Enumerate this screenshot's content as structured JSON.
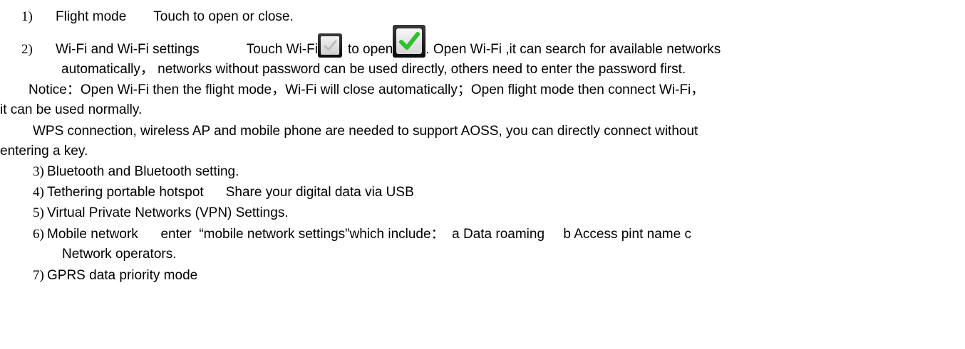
{
  "items": {
    "i1": {
      "num": "1)",
      "title": "Flight mode",
      "desc": "Touch to open or close."
    },
    "i2": {
      "num": "2)",
      "title": "Wi-Fi and Wi-Fi settings",
      "touch": "Touch Wi-Fi",
      "to_open": "to open",
      "rest": ". Open Wi-Fi ,it can search for available networks",
      "cont": "automatically， networks without password can be used directly, others need to enter the password first.",
      "notice_1": "Notice：Open Wi-Fi then the flight mode，Wi-Fi will close automatically；Open flight mode then connect Wi-Fi，",
      "notice_2": "it can be used normally.",
      "wps_1": "WPS connection, wireless AP and mobile phone are needed to support AOSS, you can directly connect without",
      "wps_2": "entering a key."
    },
    "i3": {
      "num": "3)",
      "text": "Bluetooth and Bluetooth setting."
    },
    "i4": {
      "num": "4)",
      "title": "Tethering portable hotspot",
      "desc": "Share your digital data via USB"
    },
    "i5": {
      "num": "5)",
      "text": "Virtual Private Networks (VPN) Settings."
    },
    "i6": {
      "num": "6)",
      "text": "Mobile network      enter  “mobile network settings”which include：  a Data roaming     b Access pint name c",
      "cont": "Network operators."
    },
    "i7": {
      "num": "7)",
      "text": "GPRS data priority mode"
    }
  },
  "icons": {
    "unchecked": "unchecked-checkbox-icon",
    "checked": "checked-checkbox-icon",
    "check_color": "#33cc33"
  }
}
